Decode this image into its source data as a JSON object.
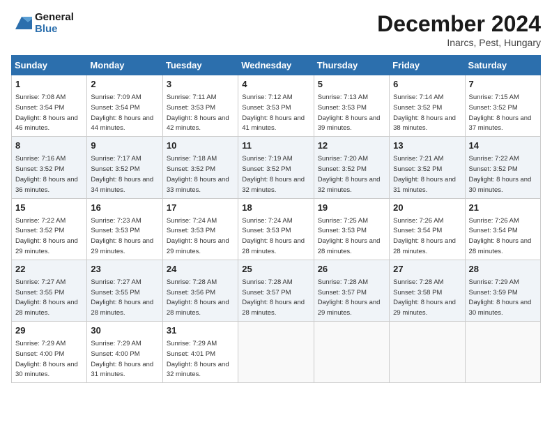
{
  "header": {
    "logo_line1": "General",
    "logo_line2": "Blue",
    "month_title": "December 2024",
    "location": "Inarcs, Pest, Hungary"
  },
  "weekdays": [
    "Sunday",
    "Monday",
    "Tuesday",
    "Wednesday",
    "Thursday",
    "Friday",
    "Saturday"
  ],
  "weeks": [
    [
      {
        "day": "1",
        "sunrise": "7:08 AM",
        "sunset": "3:54 PM",
        "daylight": "8 hours and 46 minutes."
      },
      {
        "day": "2",
        "sunrise": "7:09 AM",
        "sunset": "3:54 PM",
        "daylight": "8 hours and 44 minutes."
      },
      {
        "day": "3",
        "sunrise": "7:11 AM",
        "sunset": "3:53 PM",
        "daylight": "8 hours and 42 minutes."
      },
      {
        "day": "4",
        "sunrise": "7:12 AM",
        "sunset": "3:53 PM",
        "daylight": "8 hours and 41 minutes."
      },
      {
        "day": "5",
        "sunrise": "7:13 AM",
        "sunset": "3:53 PM",
        "daylight": "8 hours and 39 minutes."
      },
      {
        "day": "6",
        "sunrise": "7:14 AM",
        "sunset": "3:52 PM",
        "daylight": "8 hours and 38 minutes."
      },
      {
        "day": "7",
        "sunrise": "7:15 AM",
        "sunset": "3:52 PM",
        "daylight": "8 hours and 37 minutes."
      }
    ],
    [
      {
        "day": "8",
        "sunrise": "7:16 AM",
        "sunset": "3:52 PM",
        "daylight": "8 hours and 36 minutes."
      },
      {
        "day": "9",
        "sunrise": "7:17 AM",
        "sunset": "3:52 PM",
        "daylight": "8 hours and 34 minutes."
      },
      {
        "day": "10",
        "sunrise": "7:18 AM",
        "sunset": "3:52 PM",
        "daylight": "8 hours and 33 minutes."
      },
      {
        "day": "11",
        "sunrise": "7:19 AM",
        "sunset": "3:52 PM",
        "daylight": "8 hours and 32 minutes."
      },
      {
        "day": "12",
        "sunrise": "7:20 AM",
        "sunset": "3:52 PM",
        "daylight": "8 hours and 32 minutes."
      },
      {
        "day": "13",
        "sunrise": "7:21 AM",
        "sunset": "3:52 PM",
        "daylight": "8 hours and 31 minutes."
      },
      {
        "day": "14",
        "sunrise": "7:22 AM",
        "sunset": "3:52 PM",
        "daylight": "8 hours and 30 minutes."
      }
    ],
    [
      {
        "day": "15",
        "sunrise": "7:22 AM",
        "sunset": "3:52 PM",
        "daylight": "8 hours and 29 minutes."
      },
      {
        "day": "16",
        "sunrise": "7:23 AM",
        "sunset": "3:53 PM",
        "daylight": "8 hours and 29 minutes."
      },
      {
        "day": "17",
        "sunrise": "7:24 AM",
        "sunset": "3:53 PM",
        "daylight": "8 hours and 29 minutes."
      },
      {
        "day": "18",
        "sunrise": "7:24 AM",
        "sunset": "3:53 PM",
        "daylight": "8 hours and 28 minutes."
      },
      {
        "day": "19",
        "sunrise": "7:25 AM",
        "sunset": "3:53 PM",
        "daylight": "8 hours and 28 minutes."
      },
      {
        "day": "20",
        "sunrise": "7:26 AM",
        "sunset": "3:54 PM",
        "daylight": "8 hours and 28 minutes."
      },
      {
        "day": "21",
        "sunrise": "7:26 AM",
        "sunset": "3:54 PM",
        "daylight": "8 hours and 28 minutes."
      }
    ],
    [
      {
        "day": "22",
        "sunrise": "7:27 AM",
        "sunset": "3:55 PM",
        "daylight": "8 hours and 28 minutes."
      },
      {
        "day": "23",
        "sunrise": "7:27 AM",
        "sunset": "3:55 PM",
        "daylight": "8 hours and 28 minutes."
      },
      {
        "day": "24",
        "sunrise": "7:28 AM",
        "sunset": "3:56 PM",
        "daylight": "8 hours and 28 minutes."
      },
      {
        "day": "25",
        "sunrise": "7:28 AM",
        "sunset": "3:57 PM",
        "daylight": "8 hours and 28 minutes."
      },
      {
        "day": "26",
        "sunrise": "7:28 AM",
        "sunset": "3:57 PM",
        "daylight": "8 hours and 29 minutes."
      },
      {
        "day": "27",
        "sunrise": "7:28 AM",
        "sunset": "3:58 PM",
        "daylight": "8 hours and 29 minutes."
      },
      {
        "day": "28",
        "sunrise": "7:29 AM",
        "sunset": "3:59 PM",
        "daylight": "8 hours and 30 minutes."
      }
    ],
    [
      {
        "day": "29",
        "sunrise": "7:29 AM",
        "sunset": "4:00 PM",
        "daylight": "8 hours and 30 minutes."
      },
      {
        "day": "30",
        "sunrise": "7:29 AM",
        "sunset": "4:00 PM",
        "daylight": "8 hours and 31 minutes."
      },
      {
        "day": "31",
        "sunrise": "7:29 AM",
        "sunset": "4:01 PM",
        "daylight": "8 hours and 32 minutes."
      },
      null,
      null,
      null,
      null
    ]
  ]
}
